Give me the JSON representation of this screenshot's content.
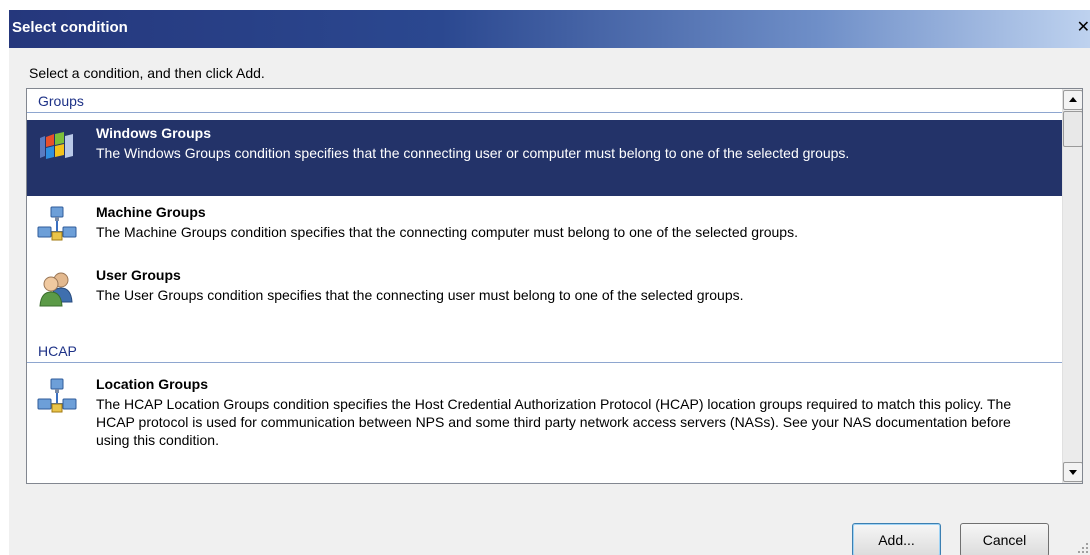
{
  "window": {
    "title": "Select condition",
    "close_glyph": "✕"
  },
  "instruction": "Select a condition, and then click Add.",
  "groups": [
    {
      "label": "Groups",
      "items": [
        {
          "title": "Windows Groups",
          "description": "The Windows Groups condition specifies that the connecting user or computer must belong to one of the selected groups.",
          "icon": "windows-flag-icon",
          "selected": true
        },
        {
          "title": "Machine Groups",
          "description": "The Machine Groups condition specifies that the connecting computer must belong to one of the selected groups.",
          "icon": "network-computers-icon",
          "selected": false
        },
        {
          "title": "User Groups",
          "description": "The User Groups condition specifies that the connecting user must belong to one of the selected groups.",
          "icon": "users-icon",
          "selected": false
        }
      ]
    },
    {
      "label": "HCAP",
      "items": [
        {
          "title": "Location Groups",
          "description": "The HCAP Location Groups condition specifies the Host Credential Authorization Protocol (HCAP) location groups required to match this policy. The HCAP protocol is used for communication between NPS and some third party network access servers (NASs). See your NAS documentation before using this condition.",
          "icon": "network-computers-icon",
          "selected": false
        }
      ]
    }
  ],
  "buttons": {
    "add": "Add...",
    "cancel": "Cancel"
  },
  "colors": {
    "selection": "#233369",
    "title_bar": "#25377c",
    "group_header_text": "#1e3287"
  }
}
